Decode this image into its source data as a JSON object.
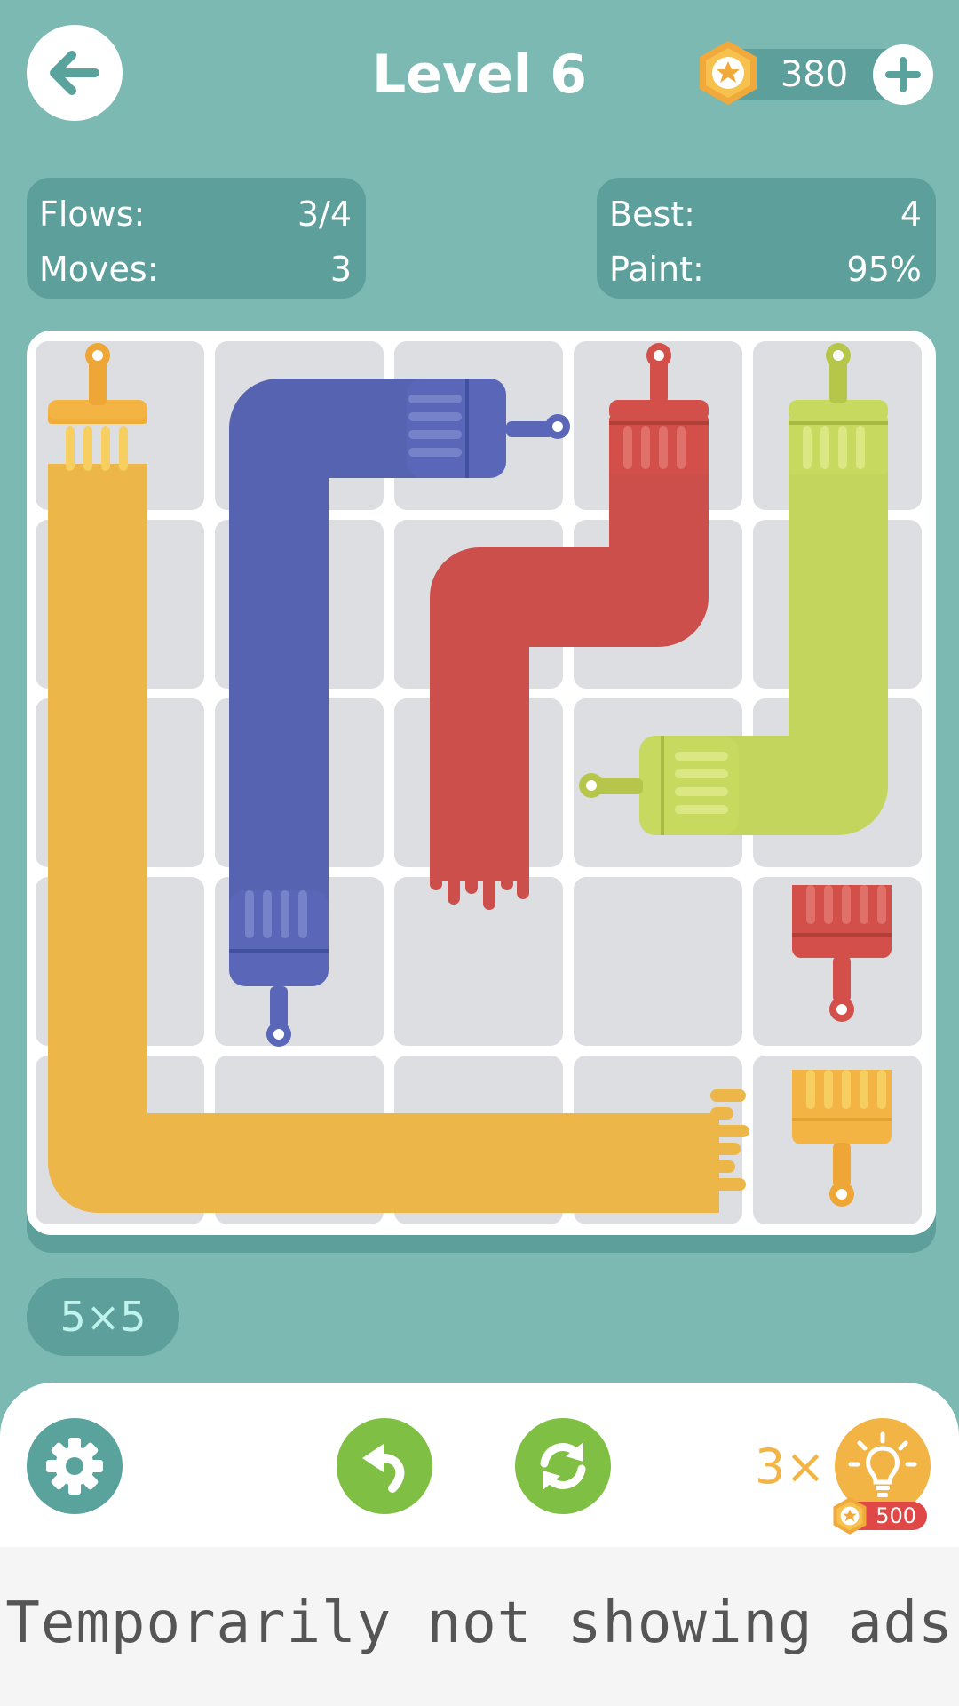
{
  "header": {
    "title": "Level 6",
    "coins": "380"
  },
  "stats_left": {
    "flows_label": "Flows:",
    "flows_value": "3/4",
    "moves_label": "Moves:",
    "moves_value": "3"
  },
  "stats_right": {
    "best_label": "Best:",
    "best_value": "4",
    "paint_label": "Paint:",
    "paint_value": "95%"
  },
  "board": {
    "size_label": "5×5",
    "rows": 5,
    "cols": 5,
    "colors": {
      "yellow": "#edb649",
      "blue": "#5563b0",
      "red": "#cd4f4b",
      "green": "#c4d55d"
    },
    "flows": [
      {
        "color": "yellow",
        "path": [
          "r1c1",
          "r2c1",
          "r3c1",
          "r4c1",
          "r5c1",
          "r5c2",
          "r5c3",
          "r5c4"
        ],
        "complete": false,
        "target": "r5c5"
      },
      {
        "color": "blue",
        "path": [
          "r1c3",
          "r1c2",
          "r2c2",
          "r3c2",
          "r4c2"
        ],
        "complete": true
      },
      {
        "color": "red",
        "path": [
          "r1c4",
          "r2c4",
          "r2c3",
          "r3c3"
        ],
        "complete": false,
        "target": "r4c5"
      },
      {
        "color": "green",
        "path": [
          "r1c5",
          "r2c5",
          "r3c5",
          "r3c4"
        ],
        "complete": true
      }
    ]
  },
  "toolbar": {
    "hint_count": "3×",
    "hint_price": "500",
    "icons": [
      "gear-icon",
      "undo-icon",
      "restart-icon",
      "lightbulb-icon"
    ]
  },
  "ad": {
    "text": "Temporarily not showing ads"
  }
}
